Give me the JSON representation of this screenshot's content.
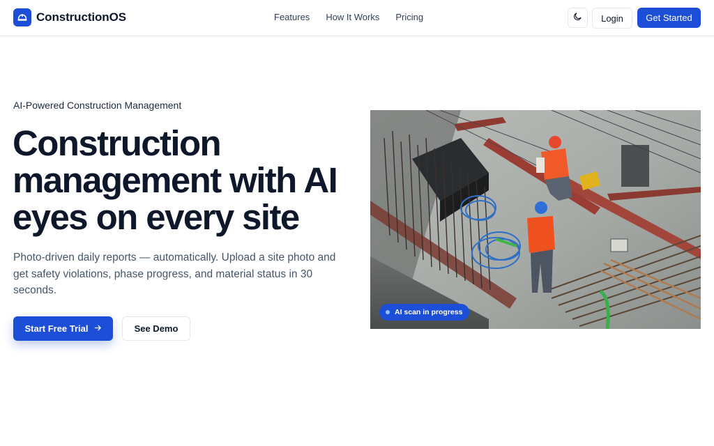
{
  "brand": {
    "name": "ConstructionOS",
    "logo_icon": "hard-hat-icon",
    "accent": "#1d4ed8"
  },
  "nav": {
    "items": [
      {
        "label": "Features"
      },
      {
        "label": "How It Works"
      },
      {
        "label": "Pricing"
      }
    ]
  },
  "header_actions": {
    "theme_icon": "moon-icon",
    "login_label": "Login",
    "cta_label": "Get Started"
  },
  "hero": {
    "eyebrow": "AI-Powered Construction Management",
    "headline": "Construction management with AI eyes on every site",
    "subheadline": "Photo-driven daily reports — automatically. Upload a site photo and get safety violations, phase progress, and material status in 30 seconds.",
    "primary_cta": "Start Free Trial",
    "primary_cta_icon": "arrow-right-icon",
    "secondary_cta": "See Demo",
    "image_badge": "AI scan in progress"
  }
}
